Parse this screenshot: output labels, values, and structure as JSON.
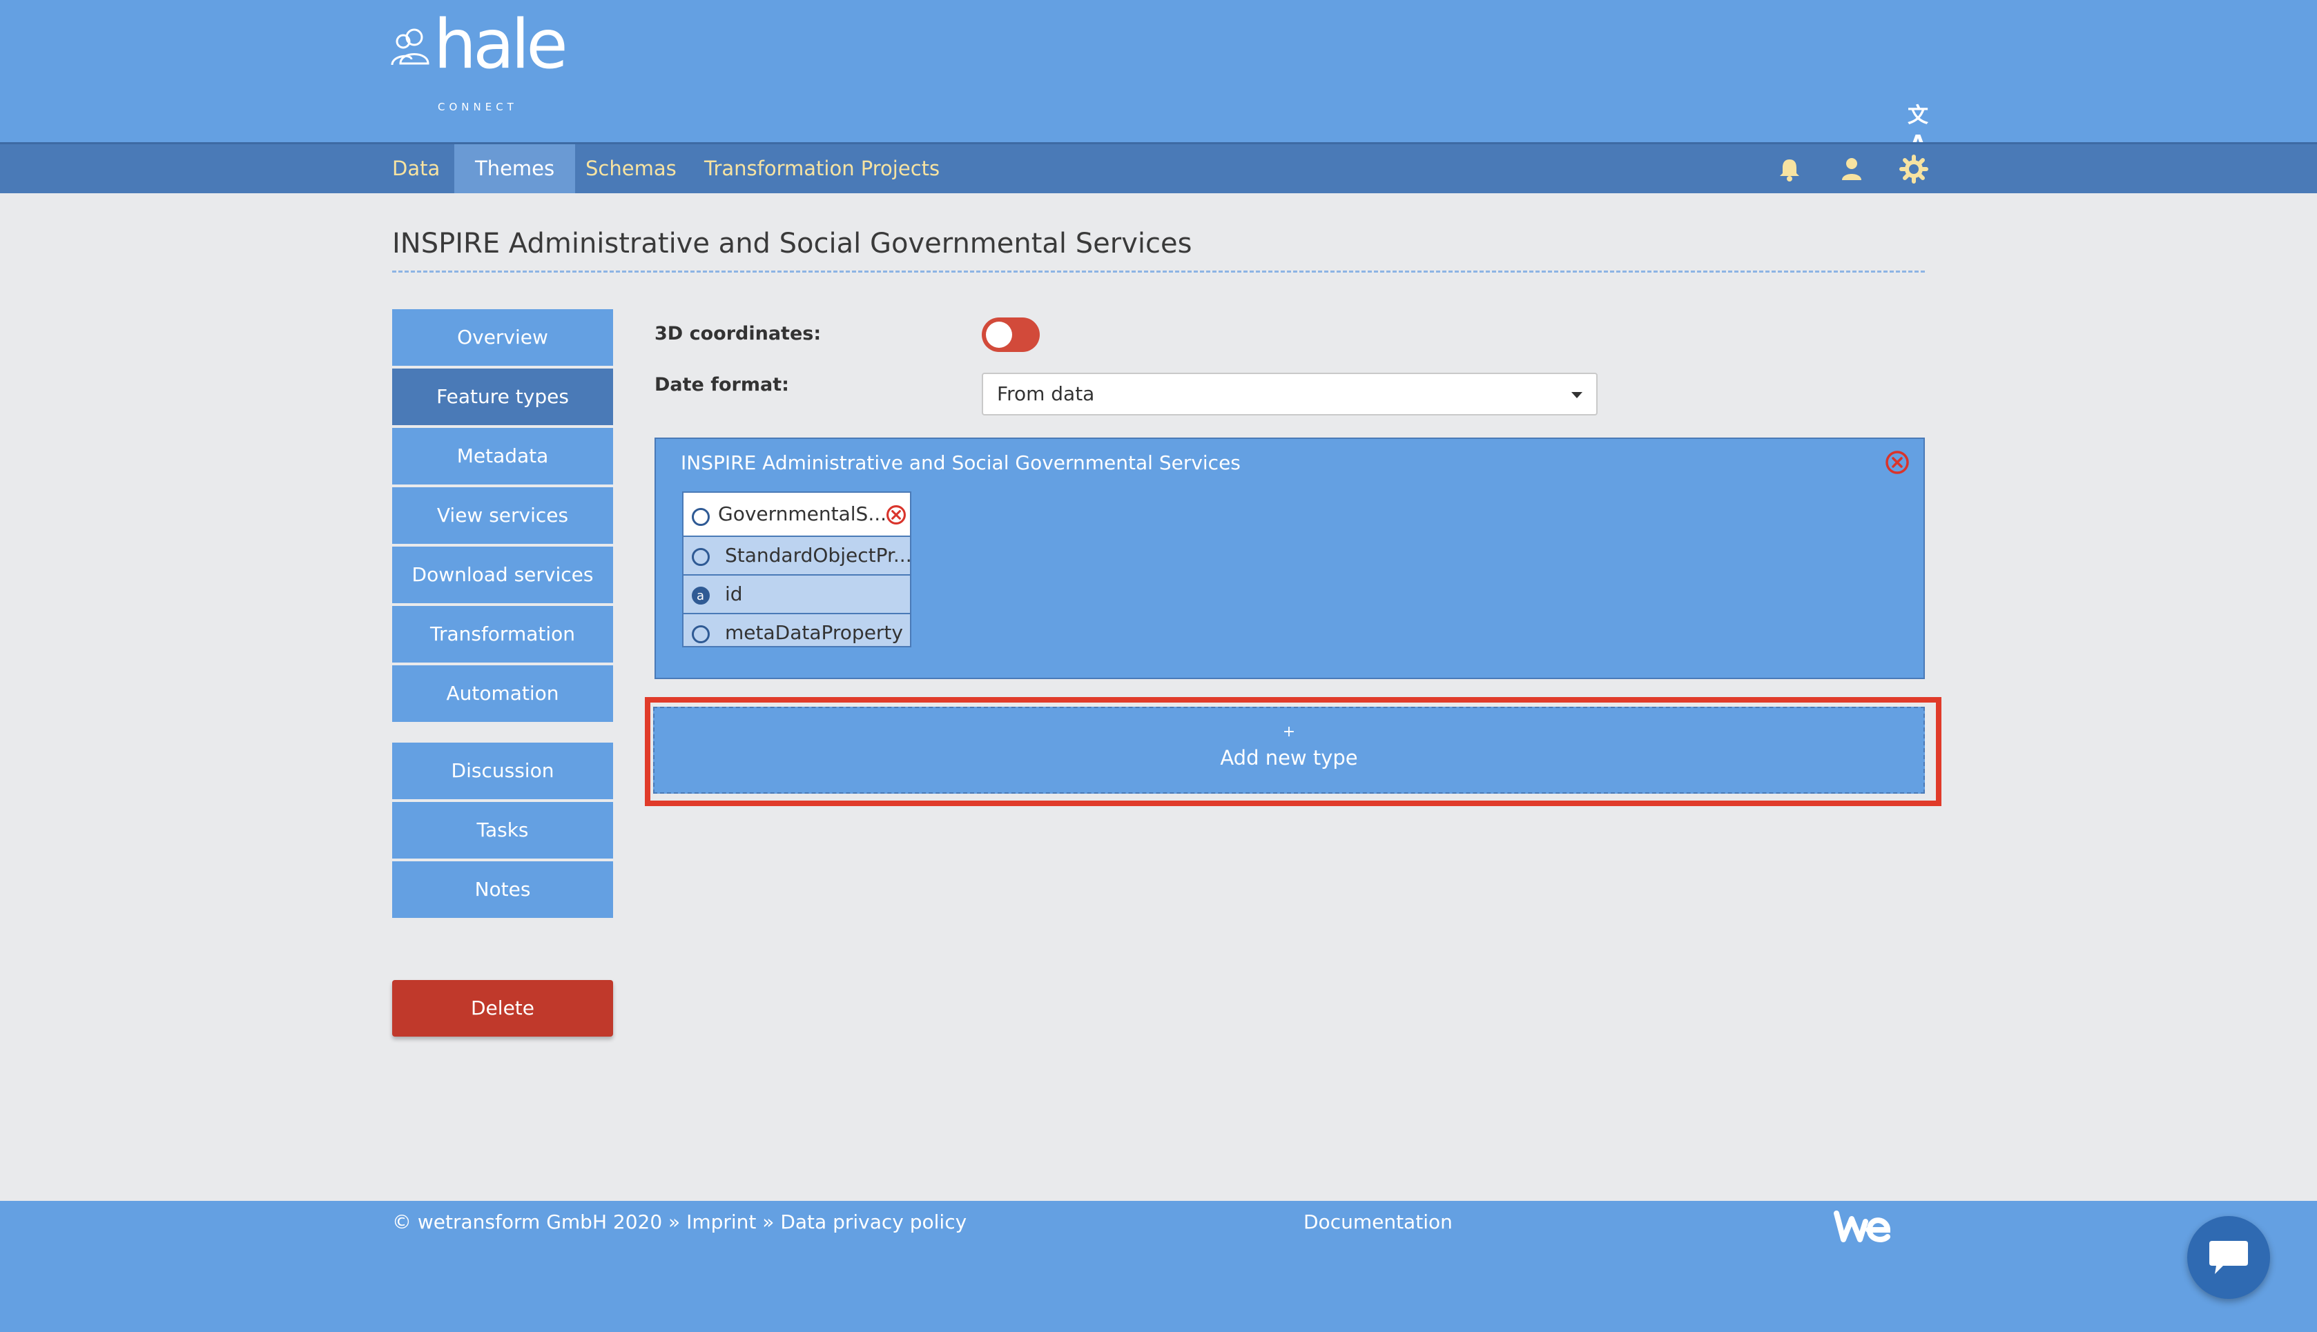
{
  "logo": {
    "wordmark": "hale",
    "subtitle": "CONNECT"
  },
  "header": {
    "translate_icon": "translate-icon"
  },
  "nav": {
    "items": [
      {
        "label": "Data"
      },
      {
        "label": "Themes",
        "active": true
      },
      {
        "label": "Schemas"
      },
      {
        "label": "Transformation Projects"
      }
    ],
    "icons": [
      "bell-icon",
      "user-icon",
      "gear-icon"
    ]
  },
  "page": {
    "title": "INSPIRE Administrative and Social Governmental Services"
  },
  "sidebar": {
    "items": [
      {
        "label": "Overview"
      },
      {
        "label": "Feature types",
        "active": true
      },
      {
        "label": "Metadata"
      },
      {
        "label": "View services"
      },
      {
        "label": "Download services"
      },
      {
        "label": "Transformation"
      },
      {
        "label": "Automation"
      },
      {
        "label": "Discussion"
      },
      {
        "label": "Tasks"
      },
      {
        "label": "Notes"
      }
    ],
    "delete_label": "Delete"
  },
  "form": {
    "coords_label": "3D coordinates:",
    "coords_enabled": false,
    "date_label": "Date format:",
    "date_value": "From data"
  },
  "type_panel": {
    "title": "INSPIRE Administrative and Social Governmental Services",
    "tree": [
      {
        "label": "GovernmentalS..."
      },
      {
        "label": "StandardObjectPr..."
      },
      {
        "label": "id"
      },
      {
        "label": "metaDataProperty"
      }
    ]
  },
  "add_type": {
    "plus": "+",
    "label": "Add new type"
  },
  "footer": {
    "copyright": "© wetransform GmbH 2020 » Imprint » Data privacy policy",
    "documentation": "Documentation"
  },
  "colors": {
    "primary": "#64a0e2",
    "nav": "#4a7ab7",
    "danger": "#c0392b",
    "highlight": "#e03b2a"
  }
}
